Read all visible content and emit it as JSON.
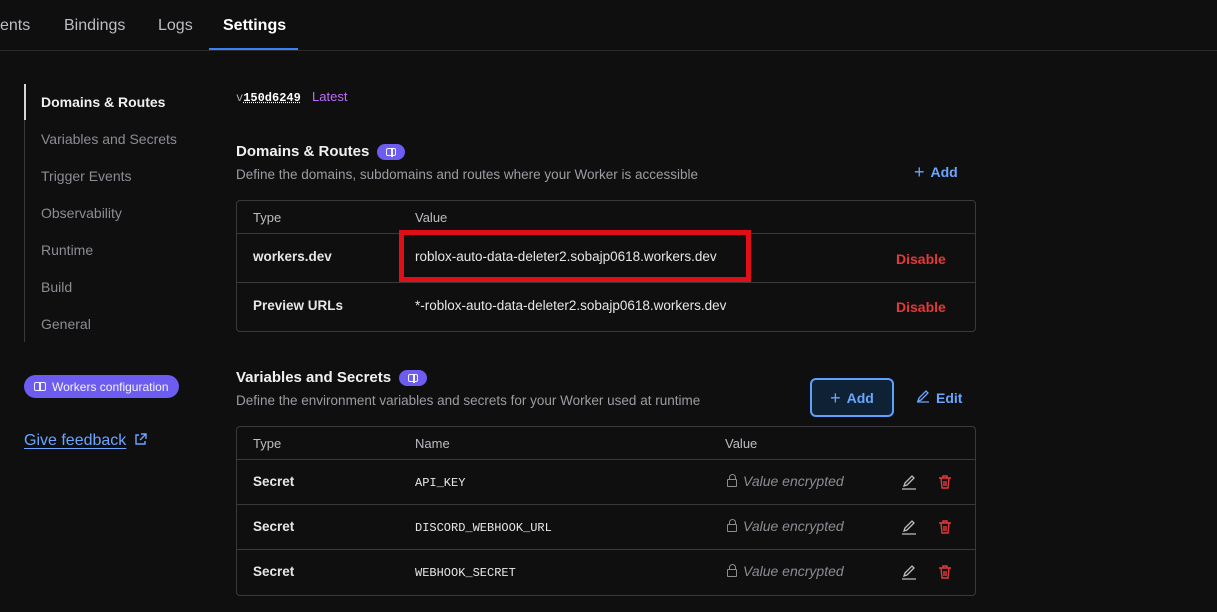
{
  "topnav": {
    "tabs": [
      {
        "label": "ents"
      },
      {
        "label": "Bindings"
      },
      {
        "label": "Logs"
      },
      {
        "label": "Settings"
      }
    ]
  },
  "sidebar": {
    "items": [
      {
        "label": "Domains & Routes"
      },
      {
        "label": "Variables and Secrets"
      },
      {
        "label": "Trigger Events"
      },
      {
        "label": "Observability"
      },
      {
        "label": "Runtime"
      },
      {
        "label": "Build"
      },
      {
        "label": "General"
      }
    ],
    "config_pill": "Workers configuration",
    "feedback": "Give feedback"
  },
  "version": {
    "prefix": "v",
    "hash": "150d6249",
    "tag": "Latest"
  },
  "domains": {
    "title": "Domains & Routes",
    "description": "Define the domains, subdomains and routes where your Worker is accessible",
    "add_label": "Add",
    "columns": [
      "Type",
      "Value"
    ],
    "rows": [
      {
        "type": "workers.dev",
        "value": "roblox-auto-data-deleter2.sobajp0618.workers.dev",
        "action": "Disable"
      },
      {
        "type": "Preview URLs",
        "value": "*-roblox-auto-data-deleter2.sobajp0618.workers.dev",
        "action": "Disable"
      }
    ]
  },
  "variables": {
    "title": "Variables and Secrets",
    "description": "Define the environment variables and secrets for your Worker used at runtime",
    "add_label": "Add",
    "edit_label": "Edit",
    "columns": [
      "Type",
      "Name",
      "Value"
    ],
    "rows": [
      {
        "type": "Secret",
        "name": "API_KEY",
        "value": "Value encrypted"
      },
      {
        "type": "Secret",
        "name": "DISCORD_WEBHOOK_URL",
        "value": "Value encrypted"
      },
      {
        "type": "Secret",
        "name": "WEBHOOK_SECRET",
        "value": "Value encrypted"
      }
    ]
  },
  "colors": {
    "accent": "#3b82f6",
    "link": "#6aa6ff",
    "danger": "#e5383b",
    "pill": "#6d5cf0",
    "highlight_box": "#e00f17"
  }
}
